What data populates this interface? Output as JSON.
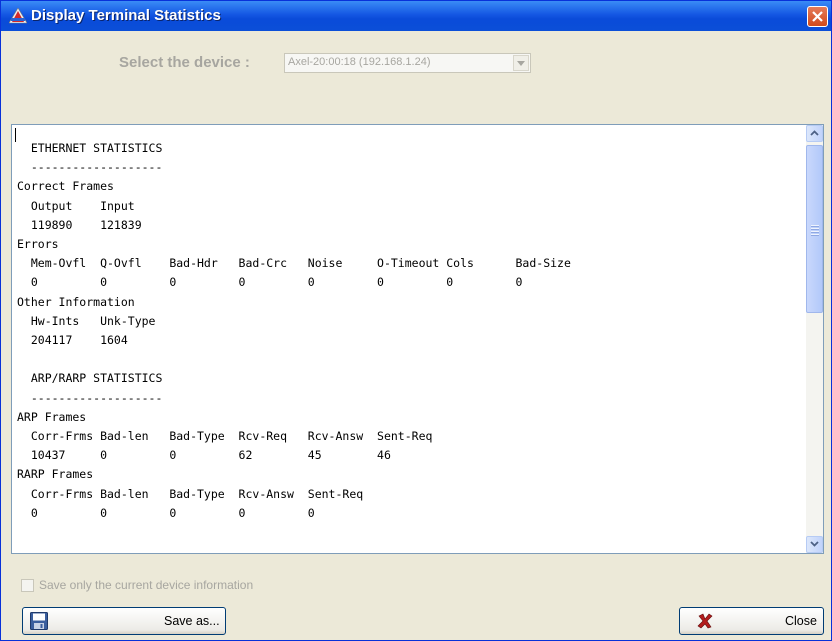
{
  "window": {
    "title": "Display Terminal Statistics"
  },
  "device": {
    "label": "Select the device :",
    "selected": "Axel-20:00:18 (192.168.1.24)"
  },
  "stats_text": "  ETHERNET STATISTICS\n  -------------------\nCorrect Frames\n  Output    Input\n  119890    121839\nErrors\n  Mem-Ovfl  Q-Ovfl    Bad-Hdr   Bad-Crc   Noise     O-Timeout Cols      Bad-Size\n  0         0         0         0         0         0         0         0\nOther Information\n  Hw-Ints   Unk-Type\n  204117    1604\n\n  ARP/RARP STATISTICS\n  -------------------\nARP Frames\n  Corr-Frms Bad-len   Bad-Type  Rcv-Req   Rcv-Answ  Sent-Req\n  10437     0         0         62        45        46\nRARP Frames\n  Corr-Frms Bad-len   Bad-Type  Rcv-Answ  Sent-Req\n  0         0         0         0         0",
  "options": {
    "save_current_only_label": "Save only the current device information",
    "save_current_only_checked": false
  },
  "buttons": {
    "save_as": "Save as...",
    "close": "Close"
  },
  "icons": {
    "app": "app-logo-icon",
    "close_window": "close-x-icon",
    "dropdown": "chevron-down-icon",
    "save": "floppy-disk-icon",
    "close": "red-x-icon",
    "scroll_up": "scroll-up-arrow-icon",
    "scroll_down": "scroll-down-arrow-icon"
  },
  "colors": {
    "titlebar": "#0a4bd9",
    "window_bg": "#ece9d8",
    "disabled_text": "#a7a6a0"
  }
}
